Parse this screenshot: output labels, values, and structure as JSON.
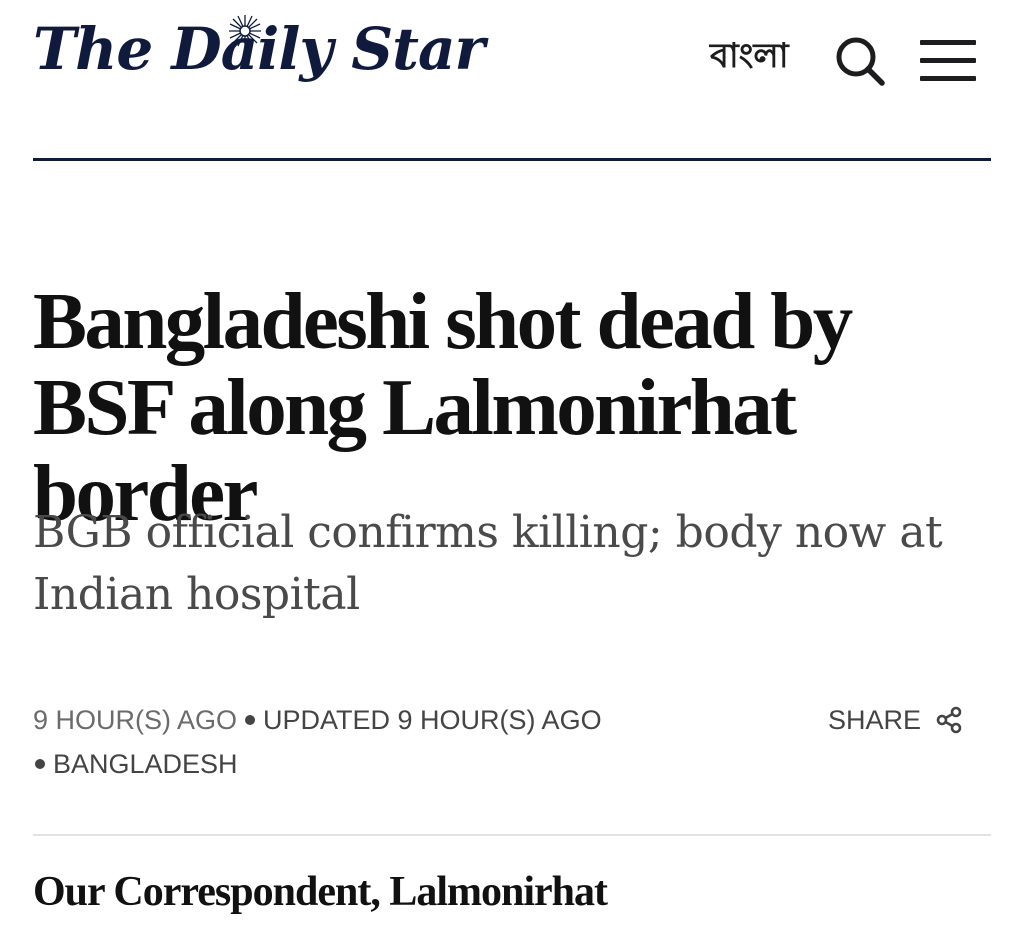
{
  "header": {
    "logo_text": "The Daily Star",
    "language_link": "বাংলা",
    "search_icon": "search-icon",
    "menu_icon": "hamburger-menu-icon",
    "brand_color": "#0f1a3d"
  },
  "article": {
    "headline": "Bangladeshi shot dead by BSF along Lalmonirhat border",
    "subheadline": "BGB official confirms killing; body now at Indian hospital",
    "published": "9 HOUR(S) AGO",
    "updated": "UPDATED 9 HOUR(S) AGO",
    "section": "BANGLADESH",
    "share_label": "SHARE",
    "share_icon": "share-icon",
    "byline": "Our Correspondent, Lalmonirhat"
  }
}
